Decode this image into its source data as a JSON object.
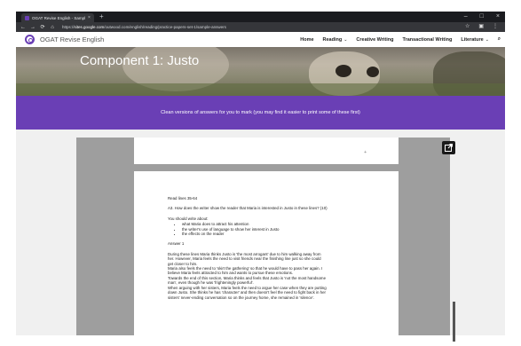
{
  "browser": {
    "tab_title": "OGAT Revise English - Sample a",
    "tab_close": "×",
    "new_tab": "+",
    "window_buttons": [
      "–",
      "□",
      "×"
    ],
    "url_prefix": "https://",
    "url_host": "sites.google.com",
    "url_path": "/outwood.com/english/reading/practice-papers-set-1/sample-answers",
    "nav_icons": [
      "←",
      "→",
      "⟳",
      "⌂"
    ],
    "right_icons": [
      "☆",
      "▣",
      "⋮"
    ]
  },
  "site": {
    "brand": "OGAT Revise English",
    "nav": [
      {
        "label": "Home",
        "chevron": ""
      },
      {
        "label": "Reading",
        "chevron": "⌄"
      },
      {
        "label": "Creative Writing",
        "chevron": ""
      },
      {
        "label": "Transactional Writing",
        "chevron": ""
      },
      {
        "label": "Literature",
        "chevron": "⌄"
      }
    ],
    "search_icon": "⌕"
  },
  "hero": {
    "title": "Component 1: Justo"
  },
  "banner": {
    "text": "Clean versions of answers for you to mark (you may find it easier to print some of these first)"
  },
  "page1": {
    "mark": "+"
  },
  "document": {
    "read_lines": "Read lines 35-64",
    "question": "A3. How does the writer show the reader that Maria is interested in Justo in these lines? (10)",
    "should_write": "You should write about:",
    "bullets": [
      "what Maria does to attract his attention",
      "the writer's use of language to show her interest in Justo",
      "the effects on the reader"
    ],
    "answer_heading": "Answer 1",
    "answer_lines": [
      "During these lines Maria thinks Justo is 'the most arrogant' due to him walking away from",
      "her. However, Maria feels the need to visit friends near the finishing line just so she could",
      "get closer to him.",
      "Maria also feels the need to 'skirt the gathering' so that he would have to pass her again. I",
      "believe Maria feels attracted to him and wants to pursue these emotions.",
      "Towards the end of this section, Maria thinks and feels that Justo is 'not the most handsome",
      "man', even though he was 'frighteningly powerful'.",
      "When arguing with her sisters, Maria feels the need to argue her case when they are putting",
      "down Justo. She thinks he has 'character' and then doesn't feel the need to fight back in her",
      "sisters' never-ending conversation so on the journey home, she remained in 'silence'."
    ]
  },
  "colors": {
    "accent": "#6a3fb5",
    "chrome": "#35363a",
    "viewer_bg": "#9e9e9e"
  }
}
